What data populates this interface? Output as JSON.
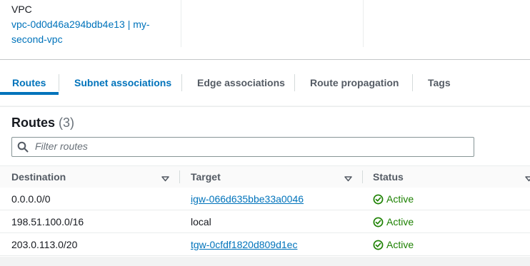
{
  "details": {
    "vpc_label": "VPC",
    "vpc_value": "vpc-0d0d46a294bdb4e13 | my-second-vpc"
  },
  "tabs": [
    {
      "label": "Routes",
      "active": true
    },
    {
      "label": "Subnet associations"
    },
    {
      "label": "Edge associations"
    },
    {
      "label": "Route propagation"
    },
    {
      "label": "Tags"
    }
  ],
  "routes": {
    "title": "Routes",
    "count": "(3)",
    "filter_placeholder": "Filter routes",
    "columns": [
      "Destination",
      "Target",
      "Status"
    ],
    "rows": [
      {
        "destination": "0.0.0.0/0",
        "target": "igw-066d635bbe33a0046",
        "target_link": true,
        "status": "Active"
      },
      {
        "destination": "198.51.100.0/16",
        "target": "local",
        "target_link": false,
        "status": "Active"
      },
      {
        "destination": "203.0.113.0/20",
        "target": "tgw-0cfdf1820d809d1ec",
        "target_link": true,
        "status": "Active"
      }
    ]
  },
  "icons": {
    "search": "search-icon",
    "sort": "caret-down-icon",
    "status": "check-circle-icon"
  },
  "colors": {
    "link": "#0073bb",
    "success": "#1d8102"
  }
}
